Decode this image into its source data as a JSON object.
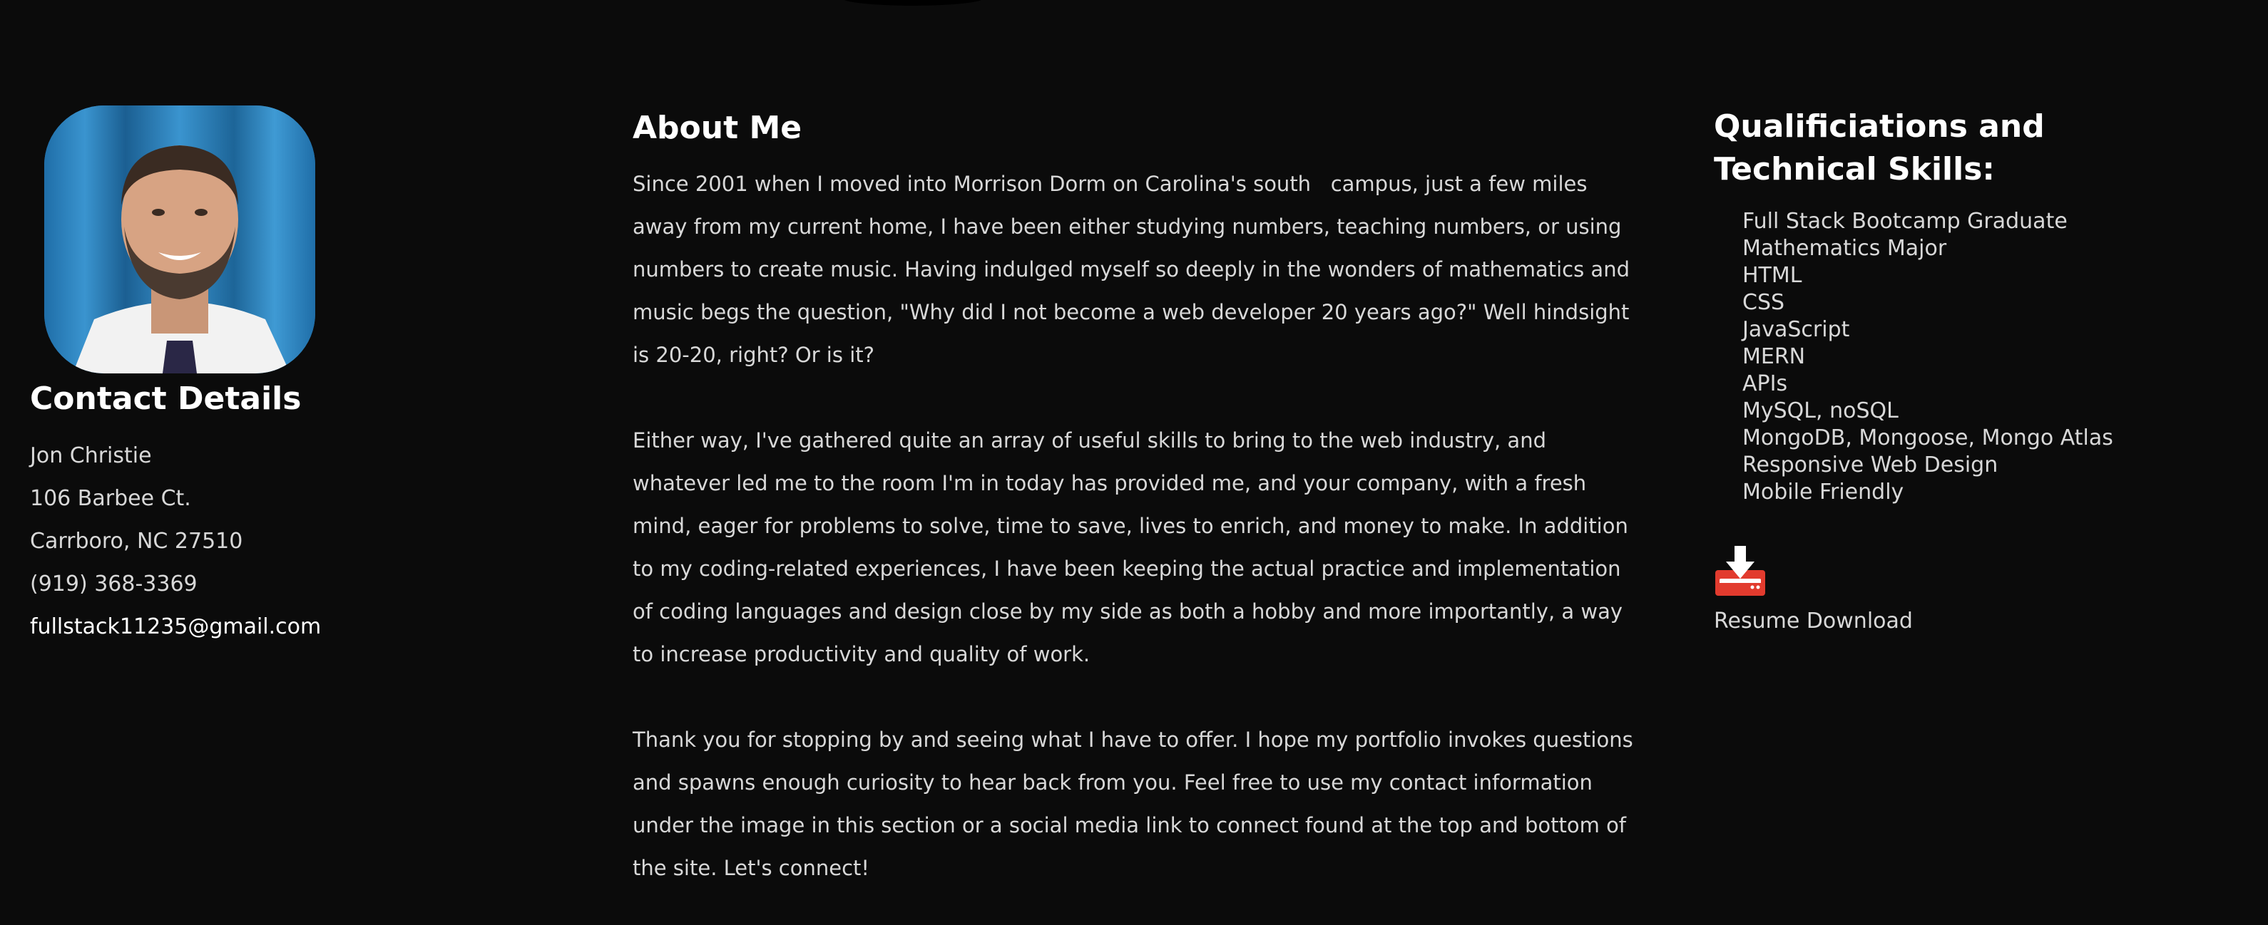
{
  "contact": {
    "title": "Contact Details",
    "name": "Jon Christie",
    "address_line1": "106 Barbee Ct.",
    "address_line2": "Carrboro, NC 27510",
    "phone": "(919) 368-3369",
    "email": "fullstack11235@gmail.com"
  },
  "about": {
    "title": "About Me",
    "paragraphs": [
      "Since 2001 when I moved into Morrison Dorm on Carolina's south   campus, just a few miles away from my current home, I have been either studying numbers, teaching numbers, or using numbers to create music. Having indulged myself so deeply in the wonders of mathematics and music begs the question, \"Why did I not become a web developer 20 years ago?\" Well hindsight is 20-20, right? Or is it?",
      "Either way, I've gathered quite an array of useful skills to bring to the web industry, and whatever led me to the room I'm in today has provided me, and your company, with a fresh mind, eager for problems to solve, time to save, lives to enrich, and money to make. In addition to my coding-related experiences, I have been keeping the actual practice and implementation of coding languages and design close by my side as both a hobby and more importantly, a way to increase productivity and quality of work.",
      "Thank you for stopping by and seeing what I have to offer. I hope my portfolio invokes questions and spawns enough curiosity to hear back from you. Feel free to use my contact information under the image in this section or a social media link to connect found at the top and bottom of the site. Let's connect!"
    ]
  },
  "skills": {
    "title": "Qualificiations and Technical Skills:",
    "items": [
      "Full Stack Bootcamp Graduate",
      "Mathematics Major",
      "HTML",
      "CSS",
      "JavaScript",
      "MERN",
      "APIs",
      "MySQL, noSQL",
      "MongoDB, Mongoose, Mongo Atlas",
      "Responsive Web Design",
      "Mobile Friendly"
    ]
  },
  "resume": {
    "label": "Resume Download",
    "icon": "download-tray-icon"
  },
  "colors": {
    "background": "#0b0b0b",
    "heading": "#ffffff",
    "text": "#d8d8d8",
    "icon_red": "#e23b2e"
  }
}
